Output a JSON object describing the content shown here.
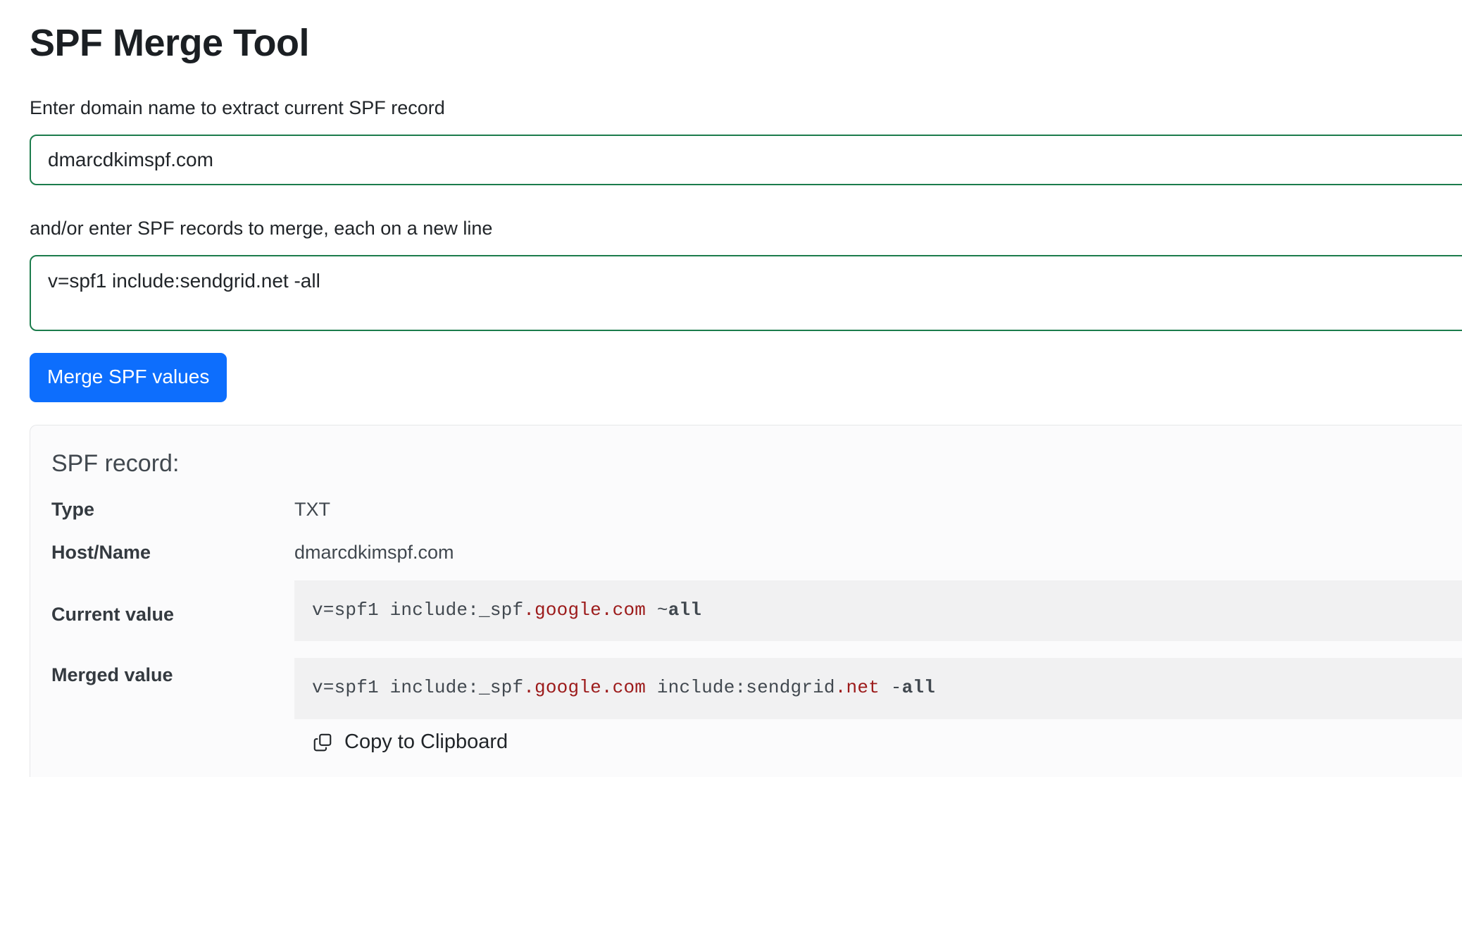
{
  "page": {
    "title": "SPF Merge Tool"
  },
  "form": {
    "domain_label": "Enter domain name to extract current SPF record",
    "domain_value": "dmarcdkimspf.com",
    "domain_placeholder": "",
    "records_label": "and/or enter SPF records to merge, each on a new line",
    "records_value": "v=spf1 include:sendgrid.net -all",
    "records_placeholder": "",
    "merge_button_label": "Merge SPF values"
  },
  "result": {
    "card_title": "SPF record:",
    "rows": {
      "type_label": "Type",
      "type_value": "TXT",
      "host_label": "Host/Name",
      "host_value": "dmarcdkimspf.com",
      "current_label": "Current value",
      "merged_label": "Merged value"
    },
    "current_value": {
      "full": "v=spf1 include:_spf.google.com ~all",
      "part1": "v=spf1 include:_spf",
      "part2": ".google.com",
      "part3": " ~",
      "part4": "all"
    },
    "merged_value": {
      "full": "v=spf1 include:_spf.google.com include:sendgrid.net -all",
      "part1": "v=spf1 include:_spf",
      "part2": ".google.com",
      "part3": " include:sendgrid",
      "part4": ".net",
      "part5": " -",
      "part6": "all"
    },
    "copy_button_label": "Copy to Clipboard",
    "copy_icon": "copy-icon"
  },
  "colors": {
    "accent_button": "#0d6efd",
    "input_border": "#1c7c4c",
    "code_background": "#f1f1f2",
    "card_background": "#fbfbfc",
    "domain_token": "#9c1a1a"
  }
}
